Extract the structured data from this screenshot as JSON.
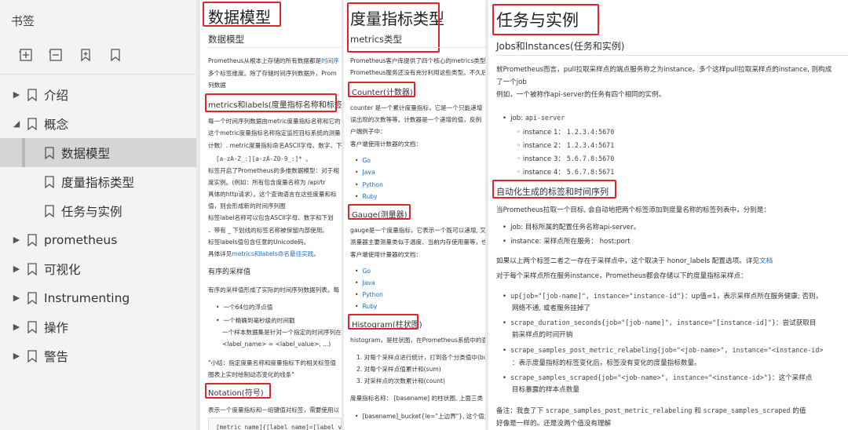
{
  "sidebar": {
    "title": "书签",
    "tools": [
      "expand-all-icon",
      "collapse-all-icon",
      "bookmark-add-icon",
      "bookmark-icon"
    ],
    "items": [
      {
        "label": "介绍",
        "toggle": "▶"
      },
      {
        "label": "概念",
        "toggle": "◢"
      },
      {
        "label": "数据模型",
        "toggle": ""
      },
      {
        "label": "度量指标类型",
        "toggle": ""
      },
      {
        "label": "任务与实例",
        "toggle": ""
      },
      {
        "label": "prometheus",
        "toggle": "▶"
      },
      {
        "label": "可视化",
        "toggle": "▶"
      },
      {
        "label": "Instrumenting",
        "toggle": "▶"
      },
      {
        "label": "操作",
        "toggle": "▶"
      },
      {
        "label": "警告",
        "toggle": "▶"
      }
    ]
  },
  "p1": {
    "heading": "数据模型",
    "subheading": "数据模型",
    "intro": [
      "Prometheus从根本上存储的所有数据都是时间序",
      "多个标签维度。除了存储时间序列数据外，Prom",
      "列数据"
    ],
    "intro_link": "时间序",
    "section1": "metrics和labels(度量指标名称和标签)",
    "s1_lines": [
      "每一个时间序列数据由metric度量指标名称和它的",
      "这个metric度量指标名称指定监控目标系统的测量",
      "计数）. metric度量指标命名ASCII字母、数字、下",
      "标签开启了Prometheus的多维数据模型：对于相",
      "度实例。(例如：所有包含度量名称为 /api/tr",
      "具体的http请求）。这个查询语言在这些度量和标",
      "值，则会形成新的时间序列图",
      "标签label名称可以包含ASCII字母、数字和下划",
      "．带有 _ 下划线的标签名称被保留内部使用。",
      "标签labels值包含任意的Unicode码。",
      "具体详见metrics和labels命名最佳实践。"
    ],
    "regex": "[a-zA-Z_:][a-zA-Z0-9_:]* 。",
    "best_link": "metrics和labels命名最佳实践",
    "samples_title": "有序的采样值",
    "samples_intro": "有序的采样值形成了实际的时间序列数据列表。每",
    "samples_bullets": [
      "一个64位的浮点值",
      "一个精确到毫秒级的时间戳"
    ],
    "sample_note": [
      "一个样本数据集是针对一个指定的时间序列在",
      "<label_name> = <label_value>, ...)"
    ],
    "summary": [
      "\"小结：指定度量名称和度量指标下的相关标签值",
      "图表上实时绘制动态变化的线条\""
    ],
    "section2": "Notation(符号)",
    "notation_line": "表示一个度量指标和一组键值对标签，需要使用以",
    "notation_code": "[metric name]{[label name]=[label value]"
  },
  "p2": {
    "heading": "度量指标类型",
    "subheading": "metrics类型",
    "intro": [
      "Prometheus客户库提供了四个核心的metrics类型。",
      "Prometheus服务还没有充分利用这些类型。不久后"
    ],
    "counter_title": "Counter(计数器)",
    "counter_lines": [
      "counter 是一个累计度量指标，它是一个只能递增",
      "误出现的次数等等。计数器是一个递增的值，反例",
      "户端例子中："
    ],
    "counter_clients_title": "客户端使用计数器的文档：",
    "counter_clients": [
      "Go",
      "Java",
      "Python",
      "Ruby"
    ],
    "gauge_title": "Gauge(测量器)",
    "gauge_lines": [
      "gauge是一个度量指标，它表示一个既可以递增, 又",
      "测量器主要测量类似于温度、当前内存使用量等，也"
    ],
    "gauge_clients_title": "客户端使用计量器的文档：",
    "gauge_clients": [
      "Go",
      "Java",
      "Python",
      "Ruby"
    ],
    "histogram_title": "Histogram(柱状图)",
    "histogram_intro": "histogram，是柱状图，在Prometheus系统中的查",
    "histogram_items": [
      "1. 对每个采样点进行统计，打到各个分类值中(bu",
      "2. 对每个采样点值累计和(sum)",
      "3. 对采样点的次数累计和(count)"
    ],
    "histogram_name": "度量指标名称：  [basename]   的柱状图, 上面三类",
    "histogram_bullet": "[basename]_bucket{le=\"上边界\"}, 这个值为小"
  },
  "p3": {
    "heading": "任务与实例",
    "subheading": "Jobs和Instances(任务和实例)",
    "intro": [
      "就Prometheus而言，pull拉取采样点的端点服务称之为instance。多个这样pull拉取采样点的instance, 则构成",
      "了一个job",
      "例如，一个被称作api-server的任务有四个相同的实例。"
    ],
    "job_label": "job:",
    "job_value": "api-server",
    "instances": [
      {
        "label": "instance 1：",
        "value": "1.2.3.4:5670"
      },
      {
        "label": "instance 2：",
        "value": "1.2.3.4:5671"
      },
      {
        "label": "instance 3：",
        "value": "5.6.7.8:5670"
      },
      {
        "label": "instance 4：",
        "value": "5.6.7.8:5671"
      }
    ],
    "section": "自动化生成的标签和时间序列",
    "auto_intro": "当Prometheus拉取一个目标, 会自动地把两个标签添加到度量名称的标签列表中，分别是：",
    "auto_bullets": [
      "job: 目标所属的配置任务名称api-server。",
      "instance: 采样点所在服务：  host:port"
    ],
    "honor_line_pre": "如果以上两个标签二者之一存在于采样点中，这个取决于  honor_labels  配置选项。详见",
    "honor_link": "文档",
    "each_line": "对于每个采样点所在服务instance，Prometheus都会存储以下的度量指标采样点：",
    "metrics": [
      {
        "code": "up{job=\"[job-name]\", instance=\"instance-id\"}",
        "desc": "：up值=1，表示采样点所在服务健康; 否则，",
        "desc2": "网络不通, 或者服务挂掉了"
      },
      {
        "code": "scrape_duration_seconds{job=\"[job-name]\", instance=\"[instance-id]\"}",
        "desc": "：尝试获取目",
        "desc2": "前采样点的时间开销"
      },
      {
        "code": "scrape_samples_post_metric_relabeling{job=\"<job-name>\", instance=\"<instance-id>",
        "desc": "",
        "desc2": "：表示度量指标的标签变化后，标签没有变化的度量指标数量。"
      },
      {
        "code": "scrape_samples_scraped{job=\"<job-name>\", instance=\"<instance-id>\"}",
        "desc": "：这个采样点",
        "desc2": "目标暴露的样本点数量"
      }
    ],
    "note_pre": "备注：我查了下",
    "note_code1": "scrape_samples_post_metric_relabeling",
    "note_and": "和",
    "note_code2": "scrape_samples_scraped",
    "note_post": "的值",
    "note_line2": "好像是一样的。还是没两个值没有理解"
  },
  "colors": {
    "highlight": "#e0242d",
    "link": "#1e6fc4",
    "sidebar_bg": "#f3f3f3",
    "selected": "#d5d5d5"
  }
}
